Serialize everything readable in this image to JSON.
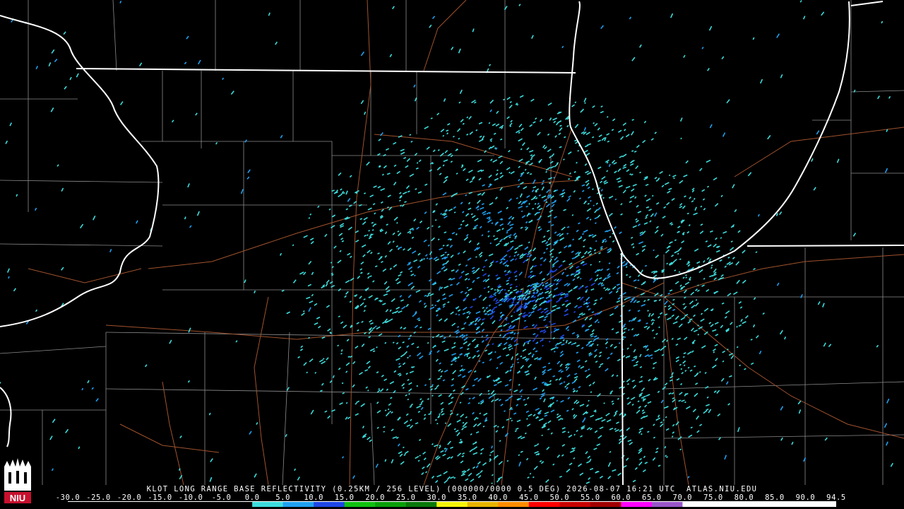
{
  "product": {
    "title": "KLOT LONG RANGE BASE REFLECTIVITY (0.25KM / 256 LEVEL) (000000/0000 0.5 DEG) 2026-08-07 16:21 UTC  ATLAS.NIU.EDU",
    "radar_site": "KLOT"
  },
  "logo": {
    "text": "NIU",
    "accent_color": "#c8102e"
  },
  "scale": {
    "labels": [
      "-30.0",
      "-25.0",
      "-20.0",
      "-15.0",
      "-10.0",
      "-5.0",
      "0.0",
      "5.0",
      "10.0",
      "15.0",
      "20.0",
      "25.0",
      "30.0",
      "35.0",
      "40.0",
      "45.0",
      "50.0",
      "55.0",
      "60.0",
      "65.0",
      "70.0",
      "75.0",
      "80.0",
      "85.0",
      "90.0",
      "94.5"
    ],
    "values": [
      -30,
      -25,
      -20,
      -15,
      -10,
      -5,
      0,
      5,
      10,
      15,
      20,
      25,
      30,
      35,
      40,
      45,
      50,
      55,
      60,
      65,
      70,
      75,
      80,
      85,
      90,
      94.5
    ],
    "colors": [
      "#000000",
      "#000000",
      "#000000",
      "#000000",
      "#000000",
      "#000000",
      "#3ddcdc",
      "#1fa0f0",
      "#1e46e6",
      "#10c010",
      "#0aa00a",
      "#0a780a",
      "#f5f50a",
      "#e6b400",
      "#ff8c00",
      "#ff0000",
      "#c80000",
      "#a00000",
      "#ff00ff",
      "#9955c9",
      "#ffffff",
      "#ffffff",
      "#ffffff",
      "#ffffff",
      "#ffffff"
    ]
  },
  "map_colors": {
    "state_border": "#ffffff",
    "county_border": "#8c8c8c",
    "highway": "#a0522d",
    "echo_light": "#3ddcdc",
    "echo_medium": "#1fa0f0",
    "echo_strong": "#1e46e6"
  }
}
